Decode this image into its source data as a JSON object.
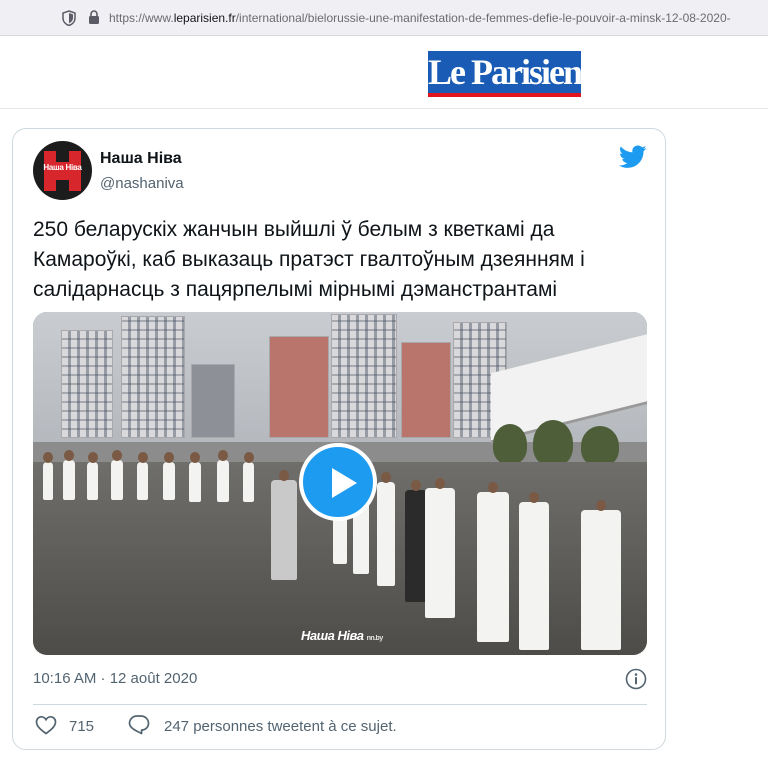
{
  "browser": {
    "url_prefix": "https://www.",
    "url_host": "leparisien.fr",
    "url_path": "/international/bielorussie-une-manifestation-de-femmes-defie-le-pouvoir-a-minsk-12-08-2020-"
  },
  "site": {
    "logo_text": "Le Parisien",
    "brand_blue": "#1a5cb5",
    "brand_red": "#e2141e"
  },
  "tweet": {
    "avatar_text": "Наша Ніва",
    "display_name": "Наша Ніва",
    "handle": "@nashaniva",
    "text": "250 беларускіх жанчын выйшлі ў белым з кветкамі да Камароўкі, каб выказаць пратэст гвалтоўным дзеянням і салідарнасць з пацярпелымі мірнымі дэманстрантамі",
    "media": {
      "watermark": "Наша Ніва",
      "watermark_suffix": "nn.by",
      "play_icon": "play-icon"
    },
    "timestamp": "10:16 AM · 12 août 2020",
    "likes": "715",
    "reply_text": "247 personnes tweetent à ce sujet.",
    "accent_color": "#1d9bf0"
  }
}
